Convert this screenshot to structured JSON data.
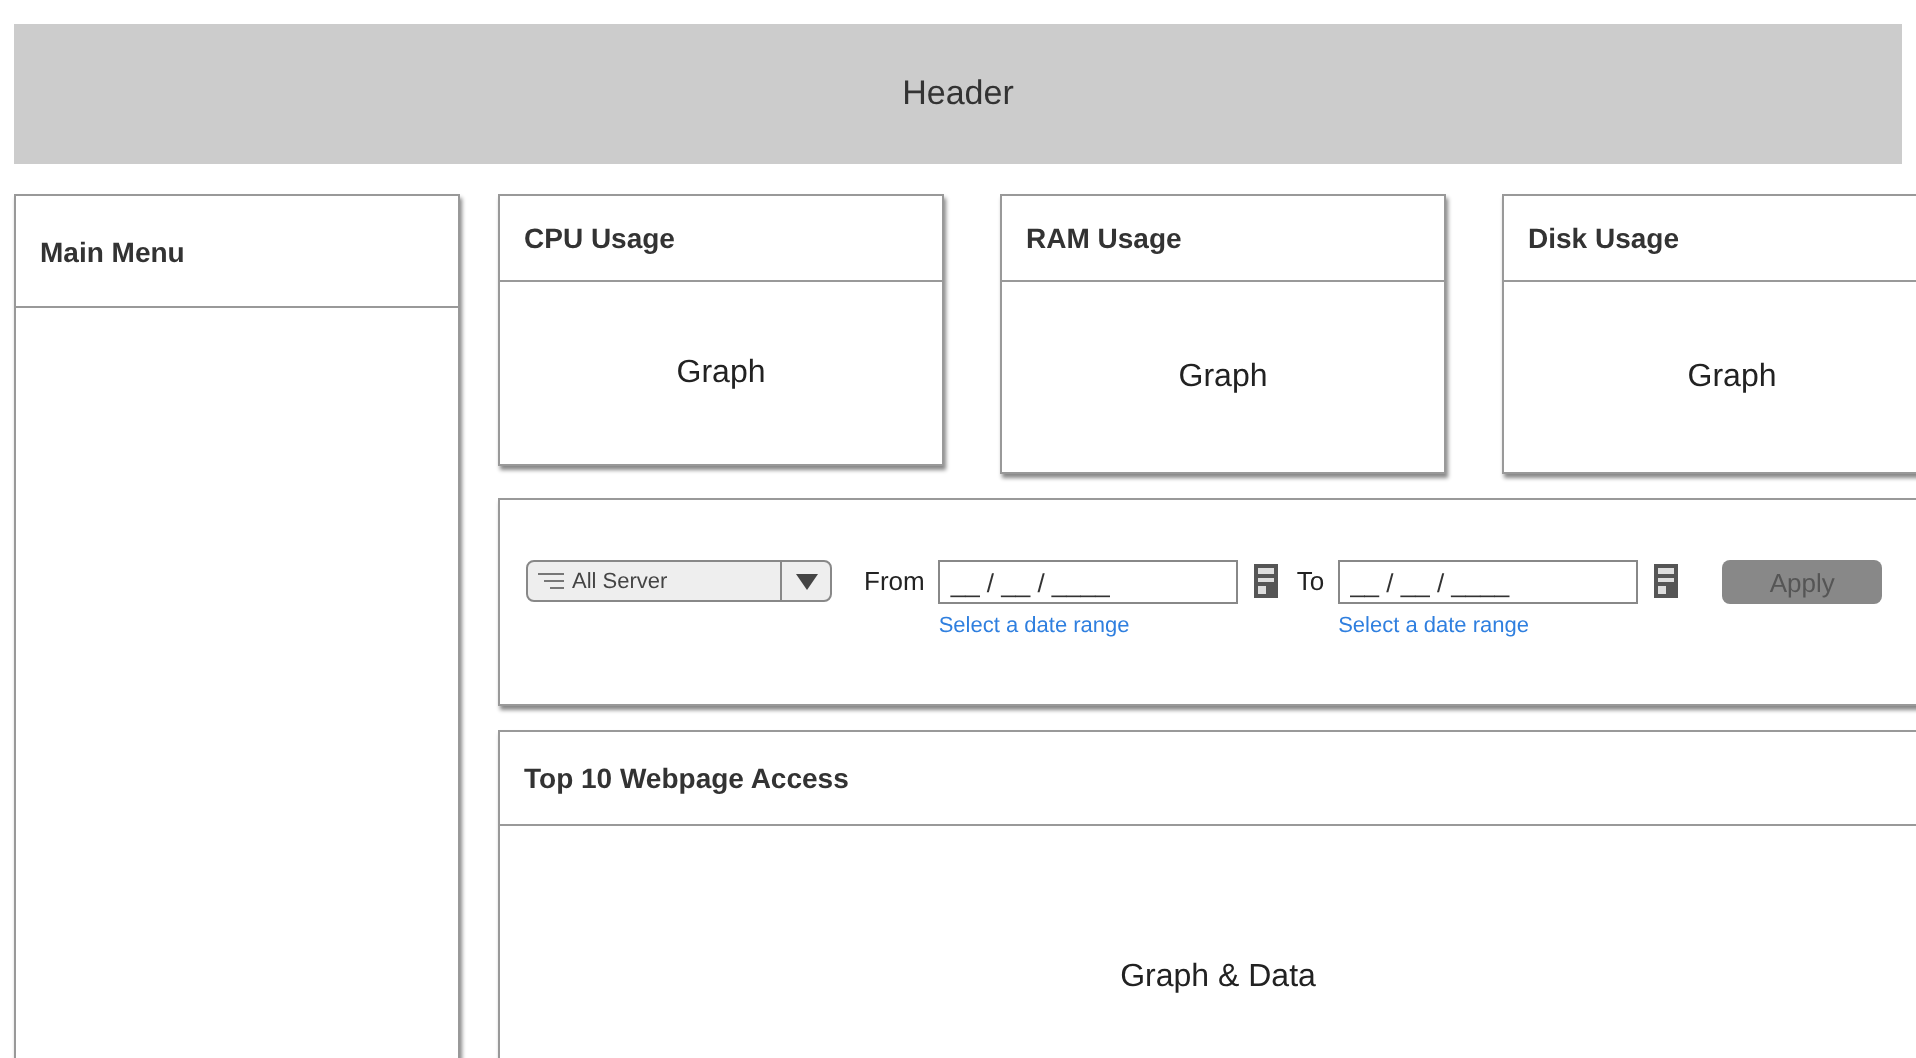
{
  "header": {
    "title": "Header"
  },
  "sidebar": {
    "title": "Main Menu"
  },
  "cards": [
    {
      "title": "CPU Usage",
      "content": "Graph"
    },
    {
      "title": "RAM Usage",
      "content": "Graph"
    },
    {
      "title": "Disk Usage",
      "content": "Graph"
    }
  ],
  "filter": {
    "server": "All Server",
    "from_label": "From",
    "from_value": "__ / __ / ____",
    "from_hint": "Select a date range",
    "to_label": "To",
    "to_value": "__ / __ / ____",
    "to_hint": "Select a date range",
    "apply": {
      "label": "Apply",
      "disabled": true
    }
  },
  "top_pages": {
    "title": "Top 10 Webpage Access",
    "content": "Graph & Data"
  }
}
